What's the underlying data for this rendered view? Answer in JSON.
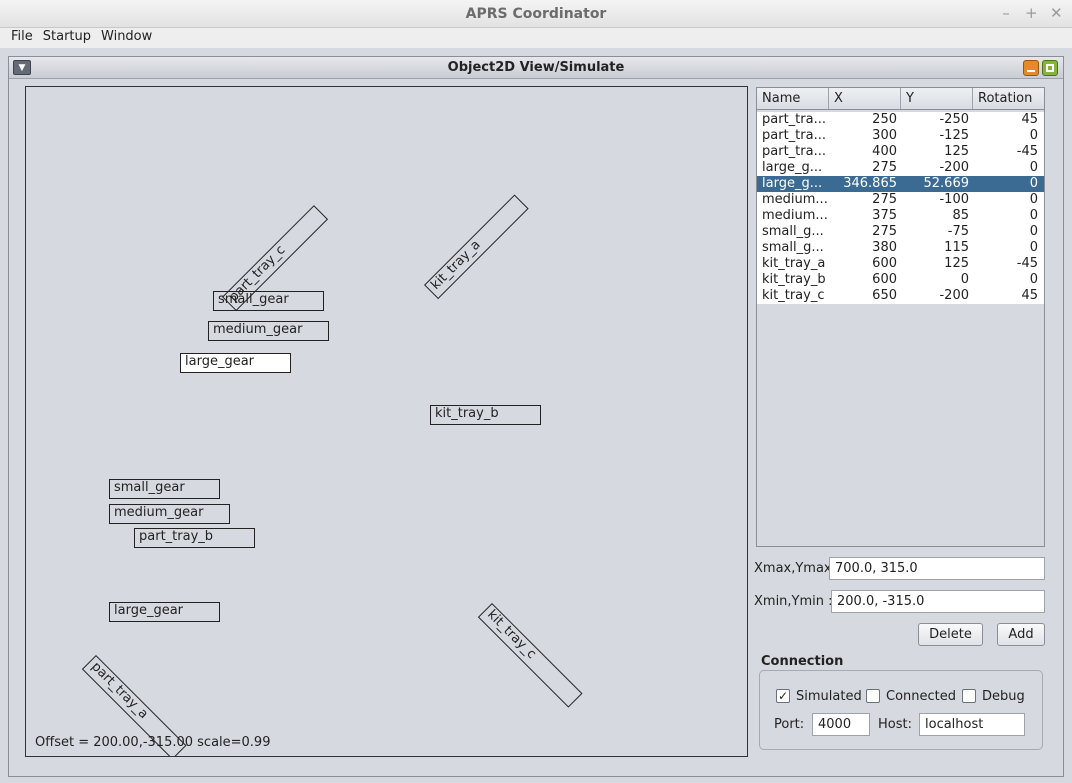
{
  "window": {
    "title": "APRS Coordinator",
    "controls": [
      "–",
      "+",
      "✕"
    ]
  },
  "menubar": {
    "items": [
      "File",
      "Startup",
      "Window"
    ]
  },
  "frame": {
    "title": "Object2D View/Simulate"
  },
  "canvas": {
    "labels": {
      "part_tray_c": "part_tray_c",
      "small_gear_1": "small_gear",
      "medium_gear_1": "medium_gear",
      "large_gear_1": "large_gear",
      "kit_tray_a": "kit_tray_a",
      "kit_tray_b": "kit_tray_b",
      "small_gear_2": "small_gear",
      "medium_gear_2": "medium_gear",
      "part_tray_b": "part_tray_b",
      "large_gear_2": "large_gear",
      "kit_tray_c": "kit_tray_c",
      "part_tray_a": "part_tray_a"
    },
    "status": "Offset = 200.00,-315.00 scale=0.99"
  },
  "table": {
    "columns": [
      "Name",
      "X",
      "Y",
      "Rotation"
    ],
    "rows": [
      {
        "name": "part_tra...",
        "x": "250",
        "y": "-250",
        "rot": "45"
      },
      {
        "name": "part_tra...",
        "x": "300",
        "y": "-125",
        "rot": "0"
      },
      {
        "name": "part_tra...",
        "x": "400",
        "y": "125",
        "rot": "-45"
      },
      {
        "name": "large_g...",
        "x": "275",
        "y": "-200",
        "rot": "0"
      },
      {
        "name": "large_g...",
        "x": "346.865",
        "y": "52.669",
        "rot": "0"
      },
      {
        "name": "medium...",
        "x": "275",
        "y": "-100",
        "rot": "0"
      },
      {
        "name": "medium...",
        "x": "375",
        "y": "85",
        "rot": "0"
      },
      {
        "name": "small_g...",
        "x": "275",
        "y": "-75",
        "rot": "0"
      },
      {
        "name": "small_g...",
        "x": "380",
        "y": "115",
        "rot": "0"
      },
      {
        "name": "kit_tray_a",
        "x": "600",
        "y": "125",
        "rot": "-45"
      },
      {
        "name": "kit_tray_b",
        "x": "600",
        "y": "0",
        "rot": "0"
      },
      {
        "name": "kit_tray_c",
        "x": "650",
        "y": "-200",
        "rot": "45"
      }
    ],
    "selected_row": 4
  },
  "bounds": {
    "max_label": "Xmax,Ymax",
    "max_value": "700.0, 315.0",
    "min_label": "Xmin,Ymin :",
    "min_value": "200.0, -315.0"
  },
  "buttons": {
    "delete": "Delete",
    "add": "Add"
  },
  "connection": {
    "title": "Connection",
    "simulated_label": "Simulated",
    "simulated_checked": true,
    "connected_label": "Connected",
    "connected_checked": false,
    "debug_label": "Debug",
    "debug_checked": false,
    "port_label": "Port:",
    "port_value": "4000",
    "host_label": "Host:",
    "host_value": "localhost"
  },
  "colors": {
    "selection": "#3b6a93",
    "background": "#d6d9df",
    "minimize": "#e38b28",
    "maximize": "#86b33a"
  }
}
